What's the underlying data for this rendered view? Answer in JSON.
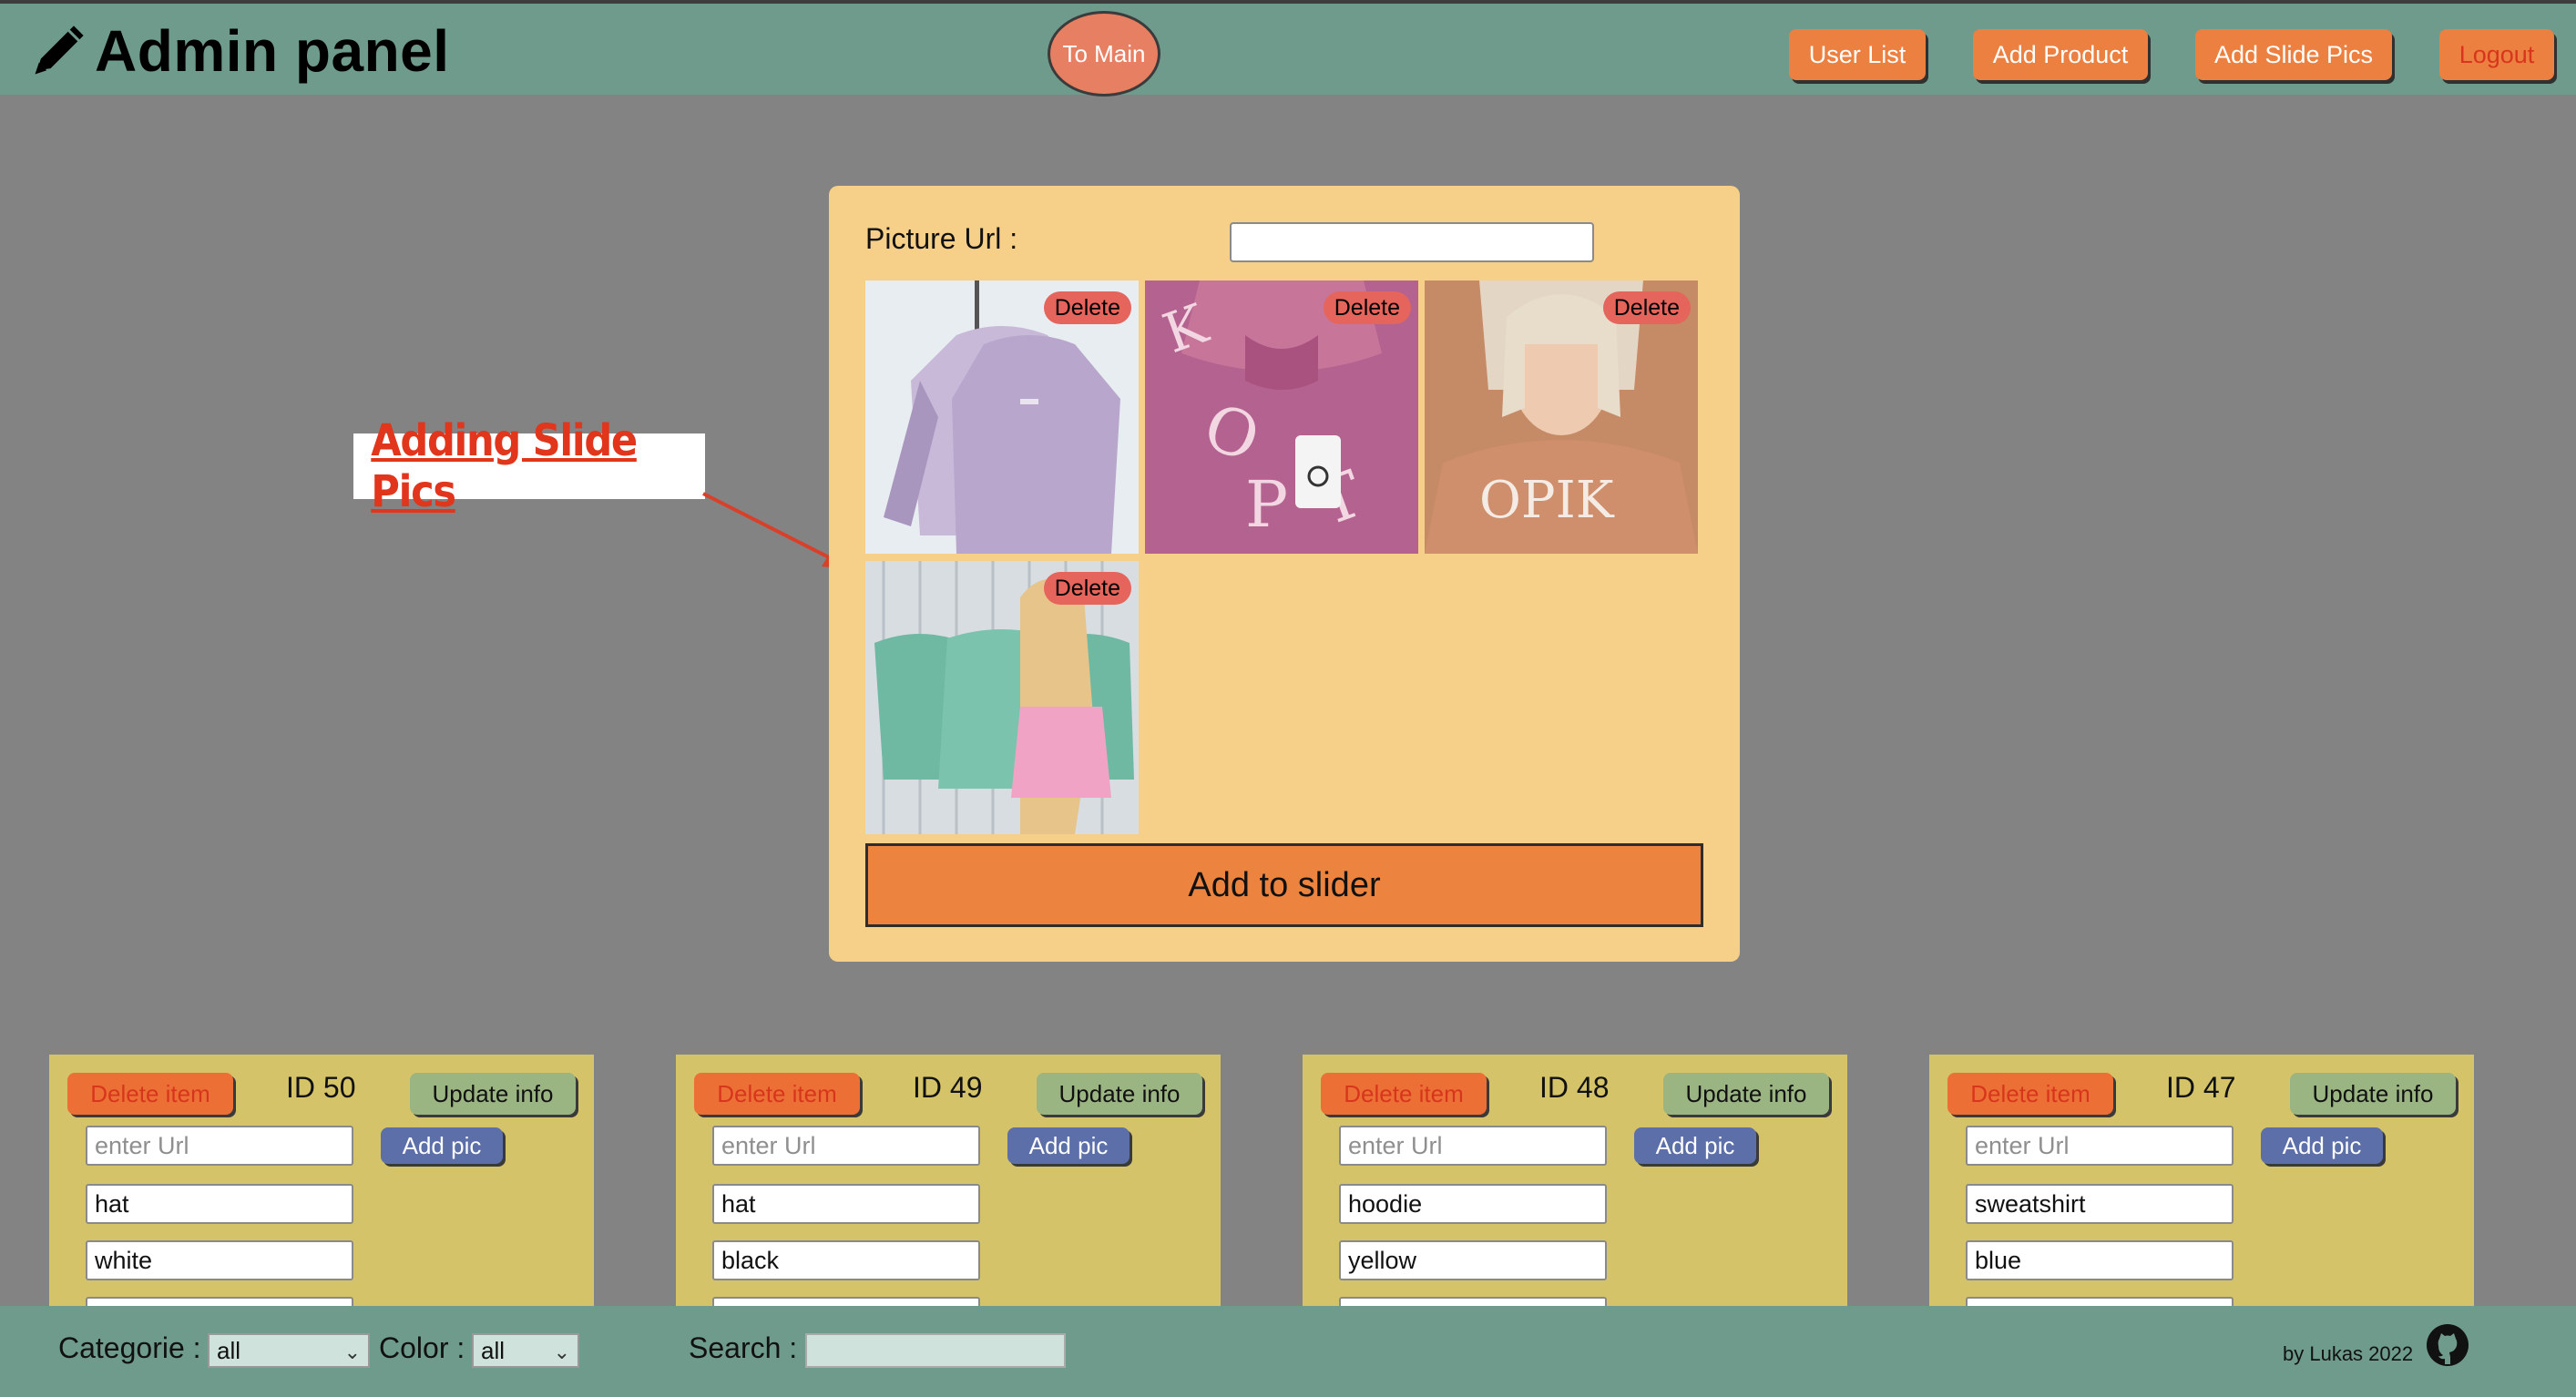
{
  "header": {
    "title": "Admin panel",
    "to_main": "To Main",
    "nav": [
      "User List",
      "Add Product",
      "Add Slide Pics",
      "Logout"
    ]
  },
  "slide_panel": {
    "url_label": "Picture Url :",
    "url_value": "",
    "delete_label": "Delete",
    "add_button": "Add to slider",
    "images": [
      {
        "desc": "lavender sweatshirts on hangers"
      },
      {
        "desc": "pink sweatshirt with white lettering"
      },
      {
        "desc": "woman in orange sweatshirt"
      },
      {
        "desc": "teal sweatshirts on rack"
      }
    ]
  },
  "annotation": "Adding Slide Pics",
  "cards": [
    {
      "id": "ID 50",
      "delete": "Delete item",
      "update": "Update info",
      "url_placeholder": "enter Url",
      "add_pic": "Add pic",
      "category": "hat",
      "color": "white"
    },
    {
      "id": "ID 49",
      "delete": "Delete item",
      "update": "Update info",
      "url_placeholder": "enter Url",
      "add_pic": "Add pic",
      "category": "hat",
      "color": "black"
    },
    {
      "id": "ID 48",
      "delete": "Delete item",
      "update": "Update info",
      "url_placeholder": "enter Url",
      "add_pic": "Add pic",
      "category": "hoodie",
      "color": "yellow"
    },
    {
      "id": "ID 47",
      "delete": "Delete item",
      "update": "Update info",
      "url_placeholder": "enter Url",
      "add_pic": "Add pic",
      "category": "sweatshirt",
      "color": "blue"
    }
  ],
  "footer": {
    "categorie_label": "Categorie :",
    "categorie_value": "all",
    "color_label": "Color :",
    "color_value": "all",
    "search_label": "Search :",
    "search_value": "",
    "credit": "by Lukas 2022"
  },
  "colors": {
    "header_bg": "#6f9b8d",
    "page_bg": "#838383",
    "panel_bg": "#f6cf88",
    "card_bg": "#d4c368",
    "orange": "#ec8040",
    "delete_red": "#e5645c"
  }
}
